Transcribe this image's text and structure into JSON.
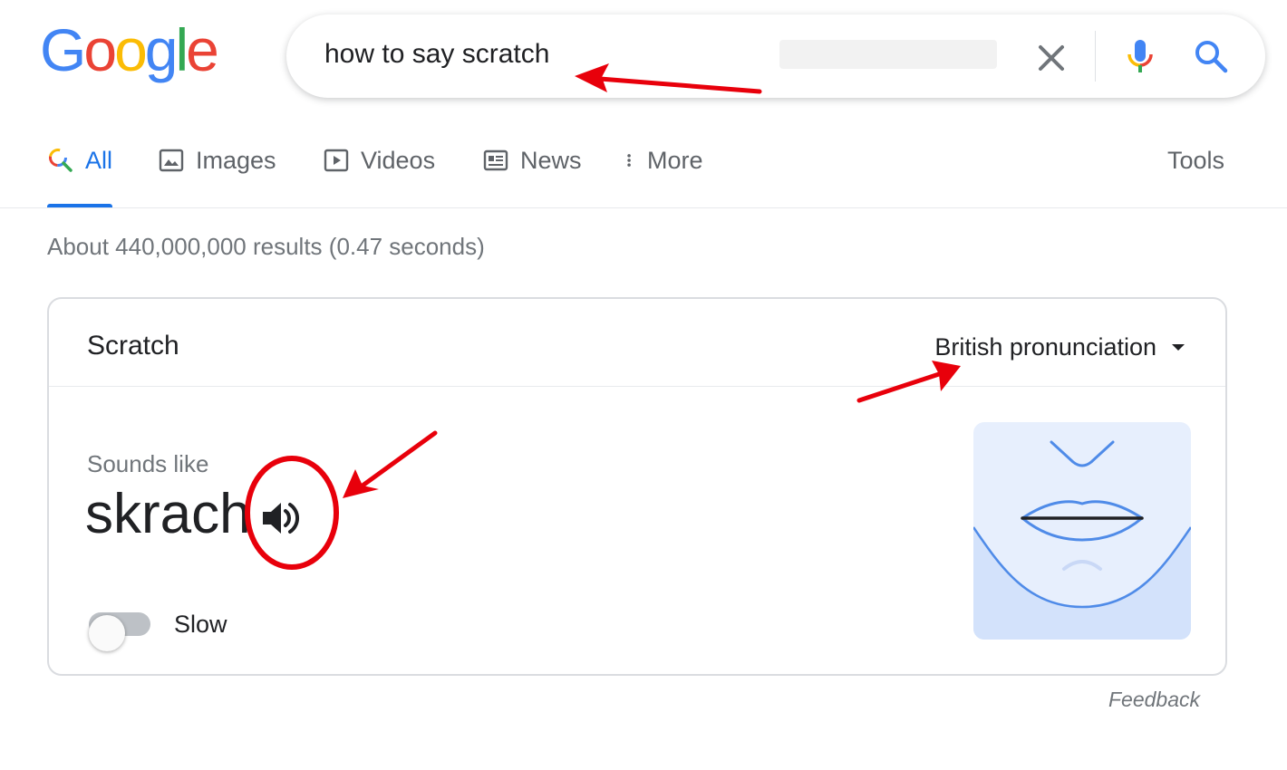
{
  "logo": {
    "letters": [
      "G",
      "o",
      "o",
      "g",
      "l",
      "e"
    ],
    "colors": [
      "#4285F4",
      "#EA4335",
      "#FBBC05",
      "#4285F4",
      "#34A853",
      "#EA4335"
    ]
  },
  "search": {
    "query": "how to say scratch",
    "icons": {
      "clear": "close-icon",
      "voice": "microphone-icon",
      "submit": "magnifier-icon"
    }
  },
  "tabs": [
    {
      "label": "All",
      "icon": "search-icon",
      "active": true
    },
    {
      "label": "Images",
      "icon": "image-icon",
      "active": false
    },
    {
      "label": "Videos",
      "icon": "play-icon",
      "active": false
    },
    {
      "label": "News",
      "icon": "newspaper-icon",
      "active": false
    },
    {
      "label": "More",
      "icon": "more-vertical-icon",
      "active": false
    }
  ],
  "tools_label": "Tools",
  "results_stats": "About 440,000,000 results (0.47 seconds)",
  "pronunciation_card": {
    "title": "Scratch",
    "dialect": "British pronunciation",
    "sounds_like_label": "Sounds like",
    "phonetic": "skrach",
    "speaker_icon": "speaker-icon",
    "slow_label": "Slow",
    "slow_enabled": false,
    "illustration": "mouth-illustration"
  },
  "feedback_label": "Feedback",
  "colors": {
    "accent_blue": "#1a73e8",
    "annotation_red": "#e8000b",
    "muted_text": "#70757a"
  }
}
